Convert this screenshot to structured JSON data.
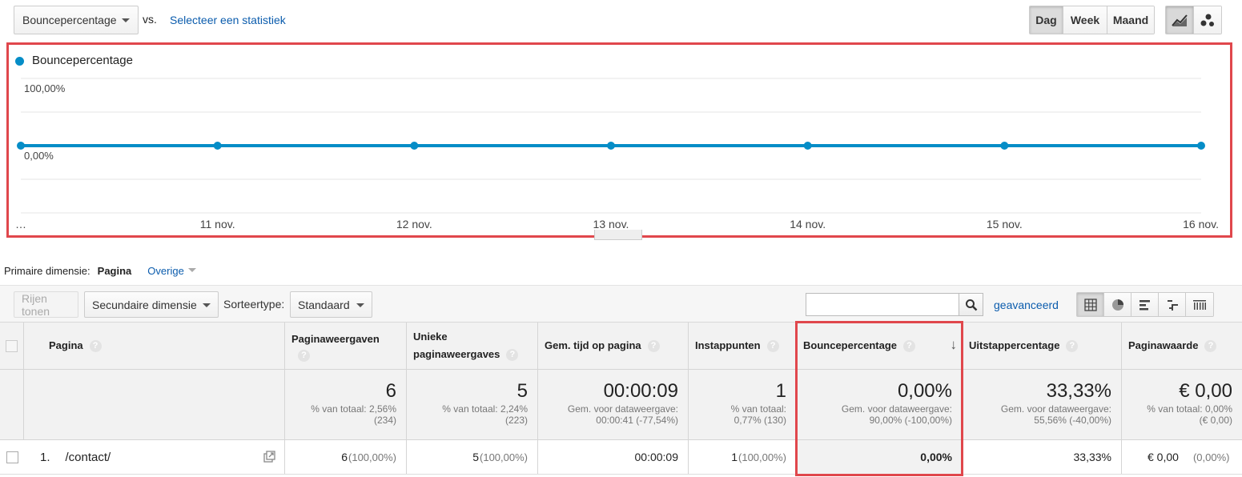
{
  "toolbar": {
    "metric": "Bouncepercentage",
    "vs": "vs.",
    "select_stat": "Selecteer een statistiek",
    "periods": [
      "Dag",
      "Week",
      "Maand"
    ],
    "active_period": "Dag"
  },
  "chart_data": {
    "type": "line",
    "series": [
      {
        "name": "Bouncepercentage",
        "values": [
          0,
          0,
          0,
          0,
          0,
          0,
          0
        ]
      }
    ],
    "categories": [
      "…",
      "11 nov.",
      "12 nov.",
      "13 nov.",
      "14 nov.",
      "15 nov.",
      "16 nov."
    ],
    "y_ticks": [
      "100,00%",
      "0,00%"
    ],
    "ylim": [
      0,
      100
    ],
    "color": "#058dc7",
    "grid": true,
    "legend_position": "top-left"
  },
  "dimension": {
    "label": "Primaire dimensie:",
    "active": "Pagina",
    "other": "Overige"
  },
  "controls": {
    "show_rows": "Rijen tonen",
    "secondary_dimension": "Secundaire dimensie",
    "sort_label": "Sorteertype:",
    "sort_value": "Standaard",
    "search_placeholder": "",
    "advanced": "geavanceerd"
  },
  "table": {
    "columns": {
      "page": "Pagina",
      "pageviews": "Paginaweergaven",
      "unique_line1": "Unieke",
      "unique_line2": "paginaweergaves",
      "avg_time": "Gem. tijd op pagina",
      "entrances": "Instappunten",
      "bounce": "Bouncepercentage",
      "exit": "Uitstappercentage",
      "value": "Paginawaarde"
    },
    "help": "?",
    "sort_arrow": "↓",
    "totals": {
      "pageviews": {
        "value": "6",
        "sub1": "% van totaal: 2,56%",
        "sub2": "(234)"
      },
      "unique": {
        "value": "5",
        "sub1": "% van totaal: 2,24%",
        "sub2": "(223)"
      },
      "avg_time": {
        "value": "00:00:09",
        "sub1": "Gem. voor dataweergave:",
        "sub2": "00:00:41 (-77,54%)"
      },
      "entrances": {
        "value": "1",
        "sub1": "% van totaal:",
        "sub2": "0,77% (130)"
      },
      "bounce": {
        "value": "0,00%",
        "sub1": "Gem. voor dataweergave:",
        "sub2": "90,00% (-100,00%)"
      },
      "exit": {
        "value": "33,33%",
        "sub1": "Gem. voor dataweergave:",
        "sub2": "55,56% (-40,00%)"
      },
      "value": {
        "value": "€ 0,00",
        "sub1": "% van totaal: 0,00%",
        "sub2": "(€ 0,00)"
      }
    },
    "rows": [
      {
        "index": "1.",
        "page": "/contact/",
        "pageviews": "6",
        "pageviews_pct": "(100,00%)",
        "unique": "5",
        "unique_pct": "(100,00%)",
        "avg_time": "00:00:09",
        "entrances": "1",
        "entrances_pct": "(100,00%)",
        "bounce": "0,00%",
        "exit": "33,33%",
        "value": "€ 0,00",
        "value_pct": "(0,00%)"
      }
    ]
  }
}
